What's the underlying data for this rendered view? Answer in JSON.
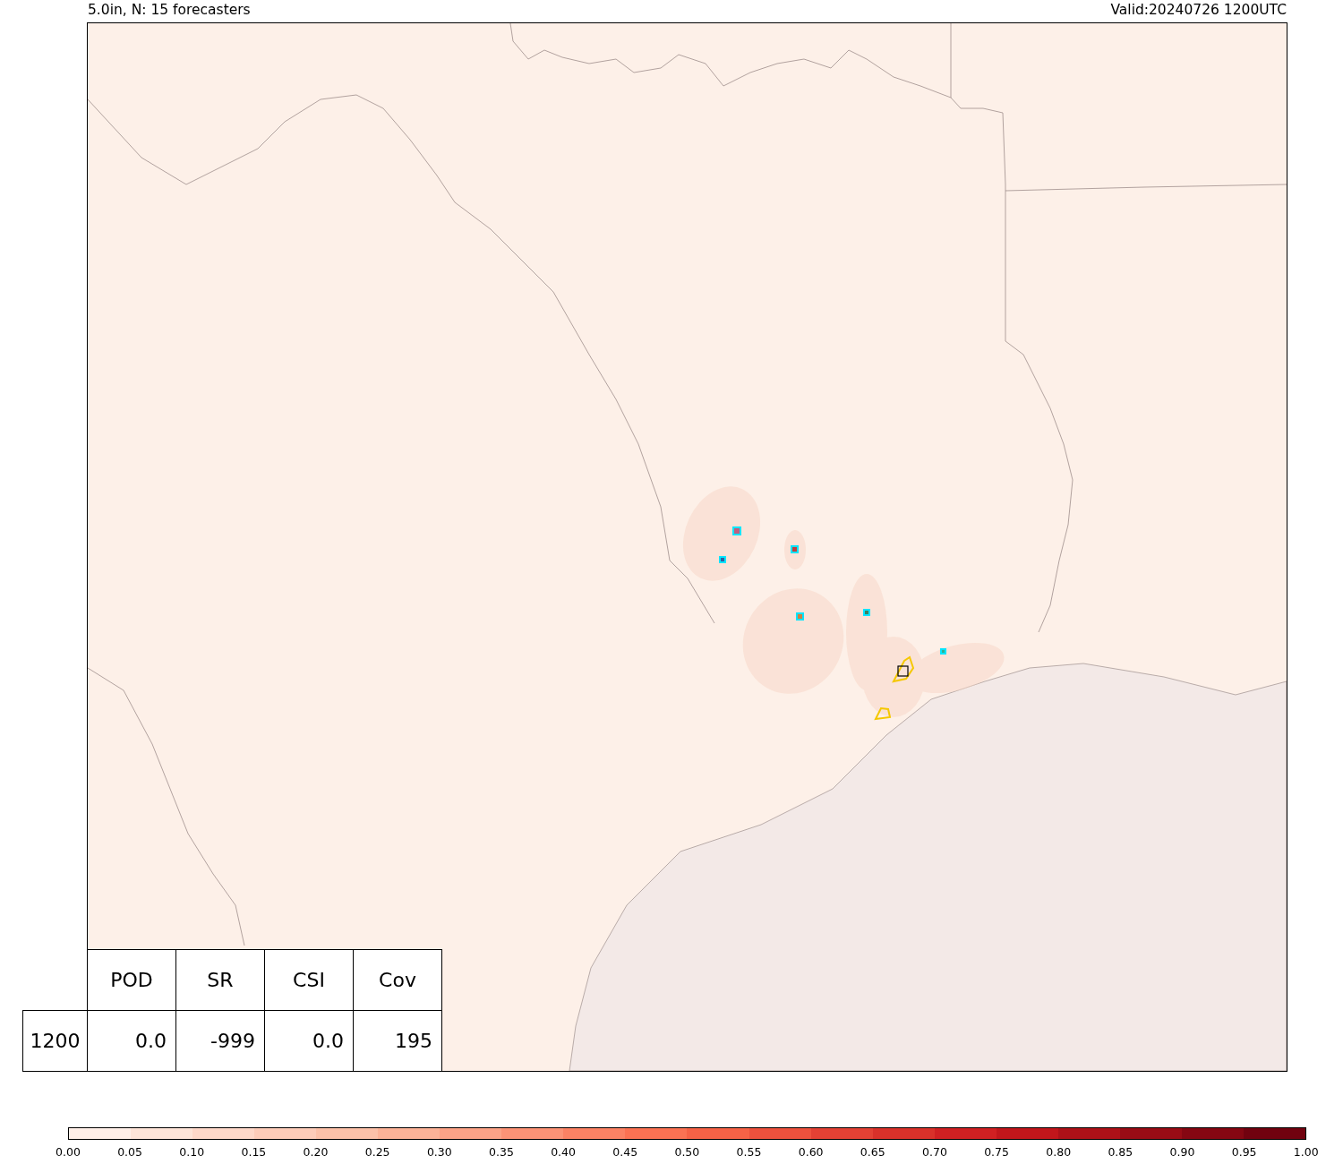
{
  "title_left": "5.0in, N: 15 forecasters",
  "title_right": "Valid:20240726 1200UTC",
  "stats_table": {
    "columns": [
      "POD",
      "SR",
      "CSI",
      "Cov"
    ],
    "rows": [
      {
        "label": "1200",
        "cells": [
          "0.0",
          "-999",
          "0.0",
          "195"
        ]
      }
    ]
  },
  "colorbar": {
    "ticks": [
      "0.00",
      "0.05",
      "0.10",
      "0.15",
      "0.20",
      "0.25",
      "0.30",
      "0.35",
      "0.40",
      "0.45",
      "0.50",
      "0.55",
      "0.60",
      "0.65",
      "0.70",
      "0.75",
      "0.80",
      "0.85",
      "0.90",
      "0.95",
      "1.00"
    ]
  }
}
